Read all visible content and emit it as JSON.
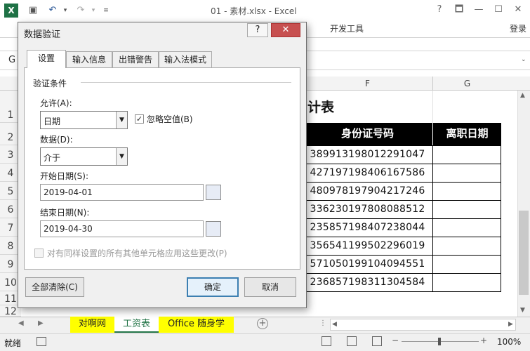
{
  "app": {
    "window_title": "01 - 素材.xlsx - Excel",
    "logo": "X",
    "window_controls": [
      "?",
      "🗖",
      "—",
      "☐",
      "✕"
    ],
    "login": "登录"
  },
  "ribbon": {
    "visible_tab": "开发工具"
  },
  "formula_bar": {
    "namebox_partial": "G"
  },
  "sheet": {
    "columns": [
      "F",
      "G"
    ],
    "rows": [
      "1",
      "2",
      "3",
      "4",
      "5",
      "6",
      "7",
      "8",
      "9",
      "10",
      "11",
      "12"
    ],
    "title_partial": "计表",
    "table_headers": [
      "身份证号码",
      "离职日期"
    ],
    "id_numbers": [
      "389913198012291047",
      "427197198406167586",
      "480978197904217246",
      "336230197808088512",
      "235857198407238044",
      "356541199502296019",
      "571050199104094551",
      "236857198311304584"
    ]
  },
  "sheet_tabs": {
    "tabs": [
      "对啊网",
      "工资表",
      "Office 随身学"
    ],
    "active": "工资表"
  },
  "status": {
    "ready": "就绪",
    "zoom": "100%"
  },
  "dialog": {
    "title": "数据验证",
    "help": "?",
    "close": "✕",
    "tabs": [
      "设置",
      "输入信息",
      "出错警告",
      "输入法模式"
    ],
    "section": "验证条件",
    "allow_label": "允许(A):",
    "allow_value": "日期",
    "ignore_blank_label": "忽略空值(B)",
    "ignore_blank_checked": "✓",
    "data_label": "数据(D):",
    "data_value": "介于",
    "start_label": "开始日期(S):",
    "start_value": "2019-04-01",
    "end_label": "结束日期(N):",
    "end_value": "2019-04-30",
    "apply_all_label": "对有同样设置的所有其他单元格应用这些更改(P)",
    "clear_all_button": "全部清除(C)",
    "ok_button": "确定",
    "cancel_button": "取消"
  },
  "colors": {
    "excel_green": "#217346",
    "tab_yellow": "#ffff00",
    "header_black": "#000000"
  }
}
